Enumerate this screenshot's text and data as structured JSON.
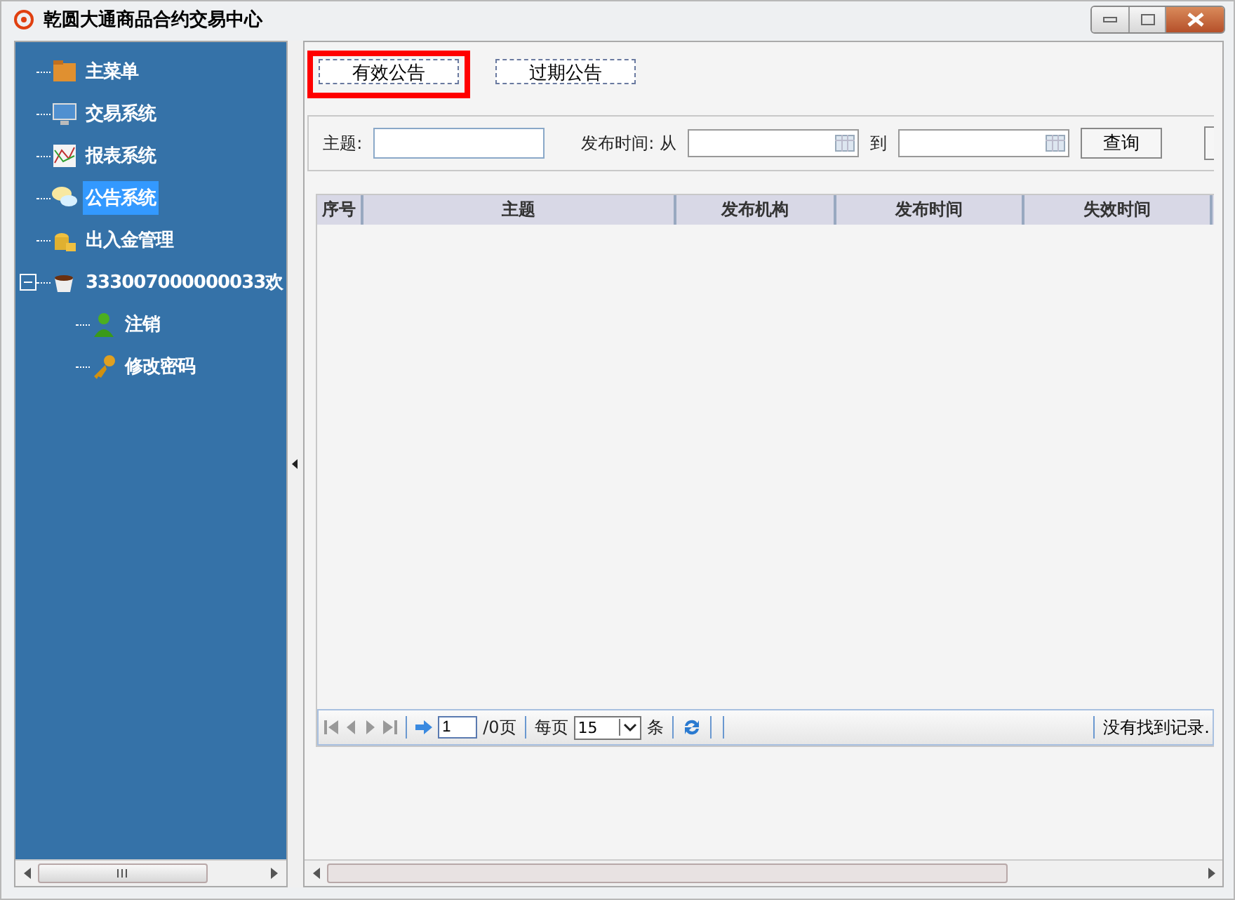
{
  "window": {
    "title": "乾圆大通商品合约交易中心"
  },
  "tree": [
    {
      "label": "主菜单",
      "selected": false
    },
    {
      "label": "交易系统",
      "selected": false
    },
    {
      "label": "报表系统",
      "selected": false
    },
    {
      "label": "公告系统",
      "selected": true
    },
    {
      "label": "出入金管理",
      "selected": false
    },
    {
      "label": "333007000000033欢",
      "selected": false,
      "expanded": true,
      "children": [
        {
          "label": "注销",
          "selected": false
        },
        {
          "label": "修改密码",
          "selected": false
        }
      ]
    }
  ],
  "tabs": [
    {
      "label": "有效公告",
      "highlighted": true
    },
    {
      "label": "过期公告",
      "highlighted": false
    }
  ],
  "filter": {
    "subject_label": "主题:",
    "time_label": "发布时间: 从",
    "to_label": "到",
    "query_button": "查询"
  },
  "table": {
    "columns": [
      "序号",
      "主题",
      "发布机构",
      "发布时间",
      "失效时间"
    ]
  },
  "pager": {
    "page": "1",
    "pages": "/0页",
    "per_page_label": "每页",
    "per_page": "15",
    "unit": "条",
    "status": "没有找到记录."
  }
}
